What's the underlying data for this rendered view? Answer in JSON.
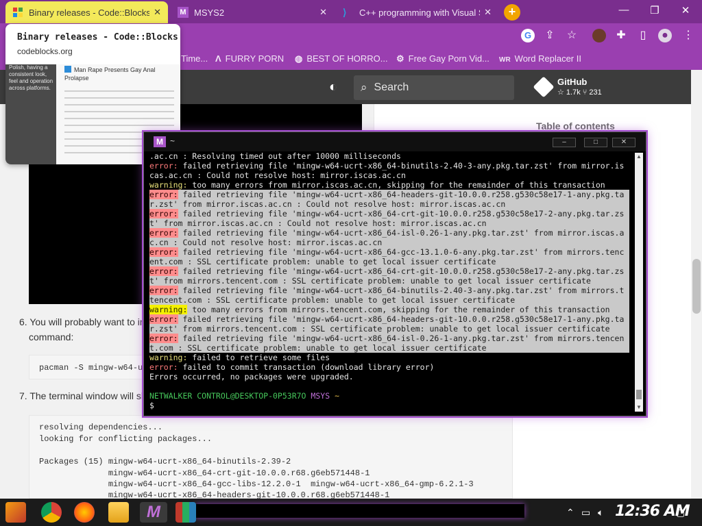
{
  "browser": {
    "tabs": [
      {
        "label": "Binary releases - Code::Blocks",
        "active": true
      },
      {
        "label": "MSYS2",
        "active": false
      },
      {
        "label": "C++ programming with Visual Studio",
        "active": false
      }
    ],
    "new_tab": "+",
    "bookmarks": [
      {
        "label": "Time...",
        "icon": "link-icon"
      },
      {
        "label": "FURRY PORN",
        "icon": "lambda-icon"
      },
      {
        "label": "BEST OF HORRO...",
        "icon": "globe-icon"
      },
      {
        "label": "Free Gay Porn Vid...",
        "icon": "gear-icon"
      },
      {
        "label": "Word Replacer II",
        "icon": "wr-icon"
      }
    ],
    "window_controls": {
      "minimize": "—",
      "maximize": "❐",
      "close": "✕"
    }
  },
  "preview": {
    "title": "Binary releases - Code::Blocks",
    "url": "codeblocks.org",
    "thumb_heading": "Man Rape Presents Gay Anal Prolapse",
    "thumb_side_text": [
      "Polish, having a",
      "consistent look,",
      "feel and operation",
      "across platforms."
    ]
  },
  "page": {
    "search_label": "Search",
    "github": {
      "name": "GitHub",
      "stats": "☆ 1.7k   ⑂ 231"
    },
    "toc": "Table of contents",
    "step6_line1": "6. You will probably want to in",
    "step6_line2": "command:",
    "step6_code": "pacman -S mingw-w64-u",
    "step7": "7. The terminal window will sh",
    "code_lines": [
      "resolving dependencies...",
      "looking for conflicting packages...",
      "",
      "Packages (15) mingw-w64-ucrt-x86_64-binutils-2.39-2",
      "              mingw-w64-ucrt-x86_64-crt-git-10.0.0.r68.g6eb571448-1",
      "              mingw-w64-ucrt-x86_64-gcc-libs-12.2.0-1  mingw-w64-ucrt-x86_64-gmp-6.2.1-3",
      "              mingw-w64-ucrt-x86_64-headers-git-10.0.0.r68.g6eb571448-1"
    ]
  },
  "terminal": {
    "title": "~",
    "lines": [
      {
        "t": ".ac.cn : Resolving timed out after 10000 milliseconds",
        "sel": false
      },
      {
        "kw": "error:",
        "t": " failed retrieving file 'mingw-w64-ucrt-x86_64-binutils-2.40-3-any.pkg.tar.zst' from mirror.is",
        "sel": false
      },
      {
        "t": "cas.ac.cn : Could not resolve host: mirror.iscas.ac.cn",
        "sel": false
      },
      {
        "kw": "warning:",
        "t": " too many errors from mirror.iscas.ac.cn, skipping for the remainder of this transaction",
        "sel": false
      },
      {
        "kw": "error:",
        "t": " failed retrieving file 'mingw-w64-ucrt-x86_64-headers-git-10.0.0.r258.g530c58e17-1-any.pkg.ta",
        "sel": true
      },
      {
        "t": "r.zst' from mirror.iscas.ac.cn : Could not resolve host: mirror.iscas.ac.cn",
        "sel": true
      },
      {
        "kw": "error:",
        "t": " failed retrieving file 'mingw-w64-ucrt-x86_64-crt-git-10.0.0.r258.g530c58e17-2-any.pkg.tar.zs",
        "sel": true
      },
      {
        "t": "t' from mirror.iscas.ac.cn : Could not resolve host: mirror.iscas.ac.cn",
        "sel": true
      },
      {
        "kw": "error:",
        "t": " failed retrieving file 'mingw-w64-ucrt-x86_64-isl-0.26-1-any.pkg.tar.zst' from mirror.iscas.a",
        "sel": true
      },
      {
        "t": "c.cn : Could not resolve host: mirror.iscas.ac.cn",
        "sel": true
      },
      {
        "kw": "error:",
        "t": " failed retrieving file 'mingw-w64-ucrt-x86_64-gcc-13.1.0-6-any.pkg.tar.zst' from mirrors.tenc",
        "sel": true
      },
      {
        "t": "ent.com : SSL certificate problem: unable to get local issuer certificate",
        "sel": true
      },
      {
        "kw": "error:",
        "t": " failed retrieving file 'mingw-w64-ucrt-x86_64-crt-git-10.0.0.r258.g530c58e17-2-any.pkg.tar.zs",
        "sel": true
      },
      {
        "t": "t' from mirrors.tencent.com : SSL certificate problem: unable to get local issuer certificate",
        "sel": true
      },
      {
        "kw": "error:",
        "t": " failed retrieving file 'mingw-w64-ucrt-x86_64-binutils-2.40-3-any.pkg.tar.zst' from mirrors.t",
        "sel": true
      },
      {
        "t": "tencent.com : SSL certificate problem: unable to get local issuer certificate",
        "sel": true
      },
      {
        "kw": "warning:",
        "t": " too many errors from mirrors.tencent.com, skipping for the remainder of this transaction",
        "sel": true
      },
      {
        "kw": "error:",
        "t": " failed retrieving file 'mingw-w64-ucrt-x86_64-headers-git-10.0.0.r258.g530c58e17-1-any.pkg.ta",
        "sel": true
      },
      {
        "t": "r.zst' from mirrors.tencent.com : SSL certificate problem: unable to get local issuer certificate",
        "sel": true
      },
      {
        "kw": "error:",
        "t": " failed retrieving file 'mingw-w64-ucrt-x86_64-isl-0.26-1-any.pkg.tar.zst' from mirrors.tencen",
        "sel": true
      },
      {
        "t": "t.com : SSL certificate problem: unable to get local issuer certificate",
        "sel": true
      },
      {
        "kw": "warning:",
        "t": " failed to retrieve some files",
        "sel": false
      },
      {
        "kw": "error:",
        "t": " failed to commit transaction (download library error)",
        "sel": false
      },
      {
        "t": "Errors occurred, no packages were upgraded.",
        "sel": false
      },
      {
        "t": "",
        "sel": false
      },
      {
        "prompt": true,
        "user": "NETWALKER CONTROL@DESKTOP-0P53R7O",
        "sys": "MSYS",
        "tilde": "~",
        "sel": false
      },
      {
        "t": "$",
        "sel": false
      }
    ]
  },
  "taskbar": {
    "clock": "12:36 AM",
    "apps": [
      "start-icon",
      "chrome-icon",
      "firefox-icon",
      "file-explorer-icon",
      "msys2-icon",
      "winrar-icon"
    ]
  },
  "colors": {
    "tab_active": "#f3e95a",
    "chrome_purple": "#9a3fb0",
    "error": "#ff7b7b",
    "warning": "#e8e07a",
    "prompt_green": "#46c75b",
    "prompt_magenta": "#c070d8"
  }
}
